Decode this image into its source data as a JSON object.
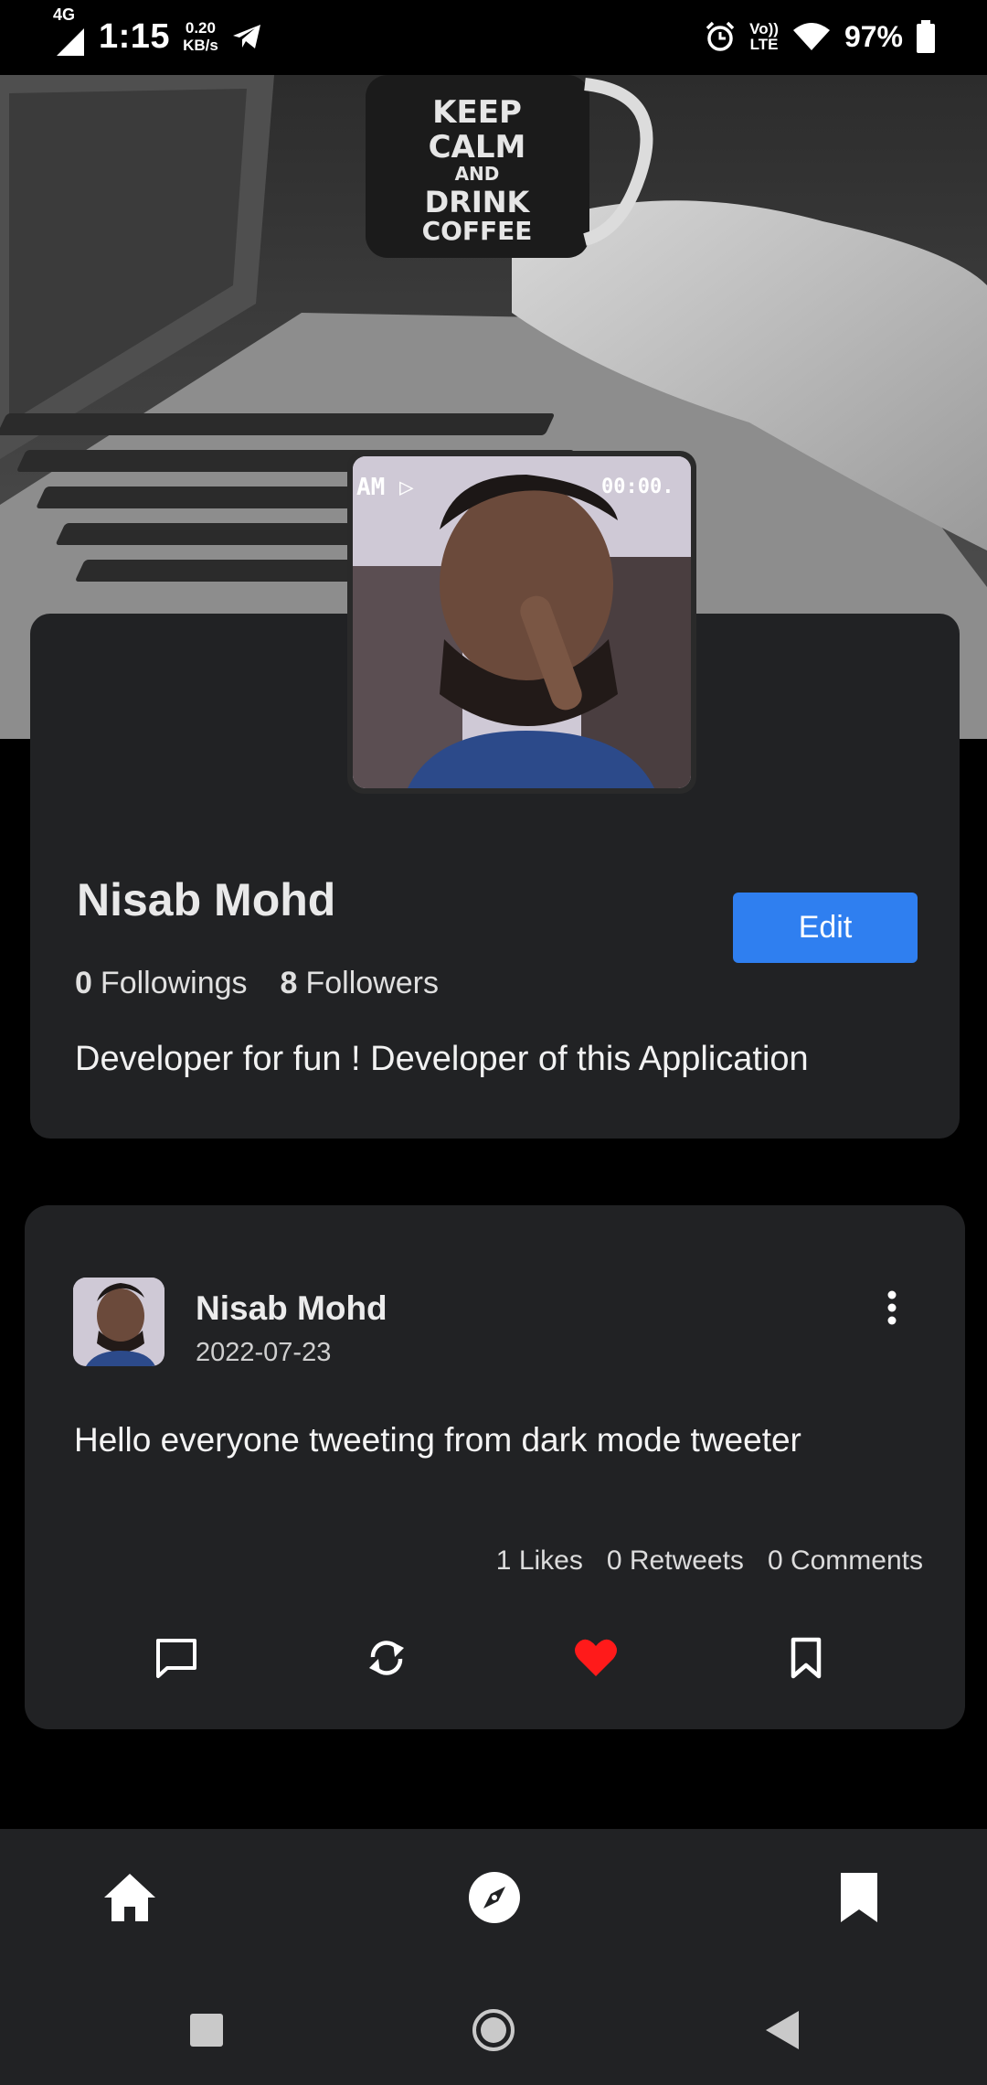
{
  "status_bar": {
    "network": "4G",
    "time": "1:15",
    "speed_value": "0.20",
    "speed_unit": "KB/s",
    "volte": "Vo))",
    "lte": "LTE",
    "battery_pct": "97%",
    "icons": [
      "signal-icon",
      "telegram-icon",
      "alarm-icon",
      "wifi-icon",
      "battery-icon"
    ]
  },
  "cover": {
    "mug_text": [
      "KEEP",
      "CALM",
      "AND",
      "DRINK",
      "COFFEE"
    ]
  },
  "profile": {
    "name": "Nisab Mohd",
    "followings_count": "0",
    "followings_label": "Followings",
    "followers_count": "8",
    "followers_label": "Followers",
    "bio": "Developer for fun ! Developer of this Application",
    "edit_label": "Edit",
    "avatar_overlay_left": "AM ▷",
    "avatar_overlay_right": "00:00."
  },
  "tweet": {
    "author": "Nisab Mohd",
    "date": "2022-07-23",
    "text": "Hello everyone tweeting from dark mode tweeter",
    "likes": "1 Likes",
    "retweets": "0 Retweets",
    "comments": "0 Comments",
    "liked": true,
    "like_color": "#ff1a1a"
  },
  "bottom_nav": {
    "items": [
      "home-icon",
      "explore-icon",
      "bookmark-icon"
    ]
  },
  "colors": {
    "background": "#000000",
    "card": "#212224",
    "accent": "#2f7ff0"
  }
}
